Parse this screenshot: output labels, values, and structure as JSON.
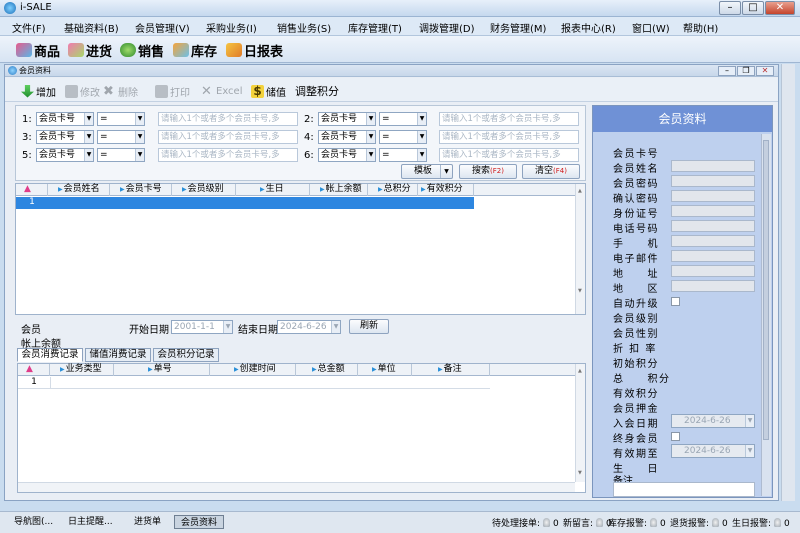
{
  "app": {
    "title": "i-SALE"
  },
  "menu": [
    "文件(F)",
    "基础资料(B)",
    "会员管理(V)",
    "采购业务(I)",
    "销售业务(S)",
    "库存管理(T)",
    "调拨管理(D)",
    "财务管理(M)",
    "报表中心(R)",
    "窗口(W)",
    "帮助(H)"
  ],
  "quickbar": [
    "商品",
    "进货",
    "销售",
    "库存",
    "日报表"
  ],
  "child": {
    "title": "会员资料",
    "toolbar": {
      "add": "增加",
      "edit": "修改",
      "delete": "删除",
      "print": "打印",
      "excel": "Excel",
      "recharge": "储值",
      "adjust": "调整积分"
    }
  },
  "filter": {
    "rows": [
      {
        "num": "1:",
        "field": "会员卡号",
        "op": "=",
        "placeholder": "请输入1个或者多个会员卡号,多"
      },
      {
        "num": "2:",
        "field": "会员卡号",
        "op": "=",
        "placeholder": "请输入1个或者多个会员卡号,多"
      },
      {
        "num": "3:",
        "field": "会员卡号",
        "op": "=",
        "placeholder": "请输入1个或者多个会员卡号,多"
      },
      {
        "num": "4:",
        "field": "会员卡号",
        "op": "=",
        "placeholder": "请输入1个或者多个会员卡号,多"
      },
      {
        "num": "5:",
        "field": "会员卡号",
        "op": "=",
        "placeholder": "请输入1个或者多个会员卡号,多"
      },
      {
        "num": "6:",
        "field": "会员卡号",
        "op": "=",
        "placeholder": "请输入1个或者多个会员卡号,多"
      }
    ],
    "template": "模板",
    "search": "搜索",
    "search_key": "(F2)",
    "clear": "清空",
    "clear_key": "(F4)"
  },
  "main_grid": {
    "columns": [
      "会员姓名",
      "会员卡号",
      "会员级别",
      "生日",
      "帐上余额",
      "总积分",
      "有效积分"
    ],
    "rows": [
      {
        "num": "1"
      }
    ]
  },
  "detail": {
    "member_label": "会员",
    "balance_label": "帐上余额",
    "start_label": "开始日期",
    "start_value": "2001-1-1",
    "end_label": "结束日期",
    "end_value": "2024-6-26",
    "refresh": "刷新",
    "tabs": [
      "会员消费记录",
      "储值消费记录",
      "会员积分记录"
    ],
    "columns": [
      "业务类型",
      "单号",
      "创建时间",
      "总金额",
      "单位",
      "备注"
    ],
    "rows": [
      {
        "num": "1"
      }
    ]
  },
  "panel": {
    "title": "会员资料",
    "fields": [
      {
        "label": "会员卡号",
        "type": "none"
      },
      {
        "label": "会员姓名",
        "type": "text"
      },
      {
        "label": "会员密码",
        "type": "text"
      },
      {
        "label": "确认密码",
        "type": "text"
      },
      {
        "label": "身份证号",
        "type": "text"
      },
      {
        "label": "电话号码",
        "type": "text"
      },
      {
        "label": "手　　机",
        "type": "text"
      },
      {
        "label": "电子邮件",
        "type": "text"
      },
      {
        "label": "地　　址",
        "type": "text"
      },
      {
        "label": "地　　区",
        "type": "text"
      },
      {
        "label": "自动升级",
        "type": "check"
      },
      {
        "label": "会员级别",
        "type": "none"
      },
      {
        "label": "会员性别",
        "type": "none"
      },
      {
        "label": "折 扣 率",
        "type": "none"
      },
      {
        "label": "初始积分",
        "type": "none"
      },
      {
        "label": "总　　积分",
        "type": "none"
      },
      {
        "label": "有效积分",
        "type": "none"
      },
      {
        "label": "会员押金",
        "type": "none"
      },
      {
        "label": "入会日期",
        "type": "date",
        "value": "2024-6-26"
      },
      {
        "label": "终身会员",
        "type": "check"
      },
      {
        "label": "有效期至",
        "type": "date",
        "value": "2024-6-26"
      },
      {
        "label": "生　　日",
        "type": "none"
      },
      {
        "label": "备注",
        "type": "none"
      }
    ]
  },
  "status": {
    "tabs": [
      "导航图(...",
      "日主提醒...",
      "进货单",
      "会员资料"
    ],
    "active_tab": 3,
    "alerts": [
      "待处理接单:",
      "新留言:",
      "库存报警:",
      "退货报警:",
      "生日报警:"
    ],
    "alert_counts": [
      "0",
      "0",
      "0",
      "0",
      "0"
    ]
  },
  "colors": {
    "accent": "#2d86e0",
    "panel_head": "#6f91d6",
    "hotkey": "#d01919"
  }
}
